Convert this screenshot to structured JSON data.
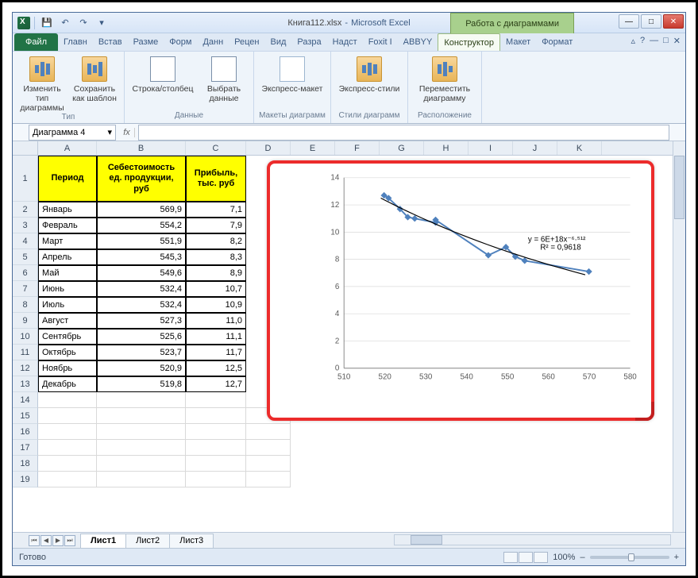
{
  "window": {
    "filename": "Книга112.xlsx",
    "app": "Microsoft Excel",
    "chart_tools": "Работа с диаграммами",
    "minimize": "—",
    "maximize": "□",
    "close": "✕"
  },
  "qat": {
    "save": "💾",
    "undo": "↶",
    "redo": "↷",
    "dropdown": "▾"
  },
  "tabs": {
    "file": "Файл",
    "items": [
      "Главн",
      "Встав",
      "Разме",
      "Форм",
      "Данн",
      "Рецен",
      "Вид",
      "Разра",
      "Надст",
      "Foxit I",
      "ABBYY",
      "Конструктор",
      "Макет",
      "Формат"
    ],
    "active_index": 11
  },
  "ribbon": {
    "groups": [
      {
        "name": "Тип",
        "buttons": [
          {
            "label": "Изменить тип\nдиаграммы",
            "icon": "change-chart"
          },
          {
            "label": "Сохранить\nкак шаблон",
            "icon": "save-template"
          }
        ]
      },
      {
        "name": "Данные",
        "buttons": [
          {
            "label": "Строка/столбец",
            "icon": "switch-rc"
          },
          {
            "label": "Выбрать\nданные",
            "icon": "select-data"
          }
        ]
      },
      {
        "name": "Макеты диаграмм",
        "buttons": [
          {
            "label": "Экспресс-макет\n",
            "icon": "quick-layout"
          }
        ]
      },
      {
        "name": "Стили диаграмм",
        "buttons": [
          {
            "label": "Экспресс-стили\n",
            "icon": "quick-styles"
          }
        ]
      },
      {
        "name": "Расположение",
        "buttons": [
          {
            "label": "Переместить\nдиаграмму",
            "icon": "move-chart"
          }
        ]
      }
    ],
    "help_icons": {
      "min": "▵",
      "help": "?",
      "winmin": "—",
      "winmax": "□",
      "winclose": "✕"
    }
  },
  "formula": {
    "namebox": "Диаграмма 4",
    "namebox_drop": "▾",
    "fx": "fx",
    "value": ""
  },
  "columns": [
    "A",
    "B",
    "C",
    "D",
    "E",
    "F",
    "G",
    "H",
    "I",
    "J",
    "K"
  ],
  "header_row": [
    "Период",
    "Себестоимость ед. продукции, руб",
    "Прибыль, тыс. руб"
  ],
  "data_rows": [
    {
      "n": "2",
      "a": "Январь",
      "b": "569,9",
      "c": "7,1"
    },
    {
      "n": "3",
      "a": "Февраль",
      "b": "554,2",
      "c": "7,9"
    },
    {
      "n": "4",
      "a": "Март",
      "b": "551,9",
      "c": "8,2"
    },
    {
      "n": "5",
      "a": "Апрель",
      "b": "545,3",
      "c": "8,3"
    },
    {
      "n": "6",
      "a": "Май",
      "b": "549,6",
      "c": "8,9"
    },
    {
      "n": "7",
      "a": "Июнь",
      "b": "532,4",
      "c": "10,7"
    },
    {
      "n": "8",
      "a": "Июль",
      "b": "532,4",
      "c": "10,9"
    },
    {
      "n": "9",
      "a": "Август",
      "b": "527,3",
      "c": "11,0"
    },
    {
      "n": "10",
      "a": "Сентябрь",
      "b": "525,6",
      "c": "11,1"
    },
    {
      "n": "11",
      "a": "Октябрь",
      "b": "523,7",
      "c": "11,7"
    },
    {
      "n": "12",
      "a": "Ноябрь",
      "b": "520,9",
      "c": "12,5"
    },
    {
      "n": "13",
      "a": "Декабрь",
      "b": "519,8",
      "c": "12,7"
    }
  ],
  "empty_rows": [
    "14",
    "15",
    "16",
    "17",
    "18",
    "19"
  ],
  "sheets": {
    "nav": [
      "⏮",
      "◀",
      "▶",
      "⏭"
    ],
    "tabs": [
      "Лист1",
      "Лист2",
      "Лист3"
    ],
    "active": 0
  },
  "statusbar": {
    "ready": "Готово",
    "zoom": "100%",
    "minus": "–",
    "plus": "+"
  },
  "chart_data": {
    "type": "scatter",
    "series": [
      {
        "name": "data",
        "points": [
          {
            "x": 569.9,
            "y": 7.1
          },
          {
            "x": 554.2,
            "y": 7.9
          },
          {
            "x": 551.9,
            "y": 8.2
          },
          {
            "x": 545.3,
            "y": 8.3
          },
          {
            "x": 549.6,
            "y": 8.9
          },
          {
            "x": 532.4,
            "y": 10.7
          },
          {
            "x": 532.4,
            "y": 10.9
          },
          {
            "x": 527.3,
            "y": 11.0
          },
          {
            "x": 525.6,
            "y": 11.1
          },
          {
            "x": 523.7,
            "y": 11.7
          },
          {
            "x": 520.9,
            "y": 12.5
          },
          {
            "x": 519.8,
            "y": 12.7
          }
        ]
      }
    ],
    "xlim": [
      510,
      580
    ],
    "ylim": [
      0,
      14
    ],
    "xticks": [
      510,
      520,
      530,
      540,
      550,
      560,
      570,
      580
    ],
    "yticks": [
      0,
      2,
      4,
      6,
      8,
      10,
      12,
      14
    ],
    "trend": {
      "equation": "y = 6E+18x⁻⁶·⁵¹²",
      "r2": "R² = 0,9618"
    }
  }
}
